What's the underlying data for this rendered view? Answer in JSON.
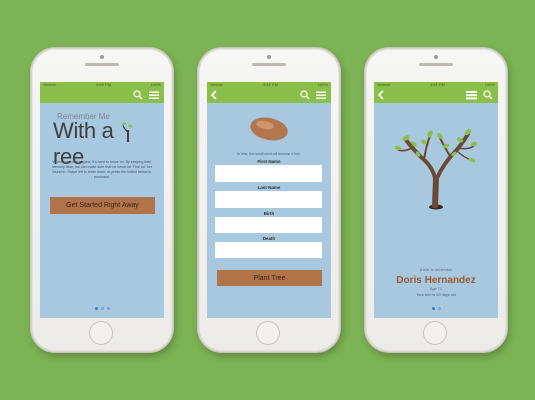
{
  "colors": {
    "background": "#7cb354",
    "header_green": "#8bbf4c",
    "screen_blue": "#a8c8e0",
    "button_brown": "#b1744a",
    "name_brown": "#9b5a33"
  },
  "status": {
    "carrier": "Verizon",
    "time_left": "9:59 PM",
    "time_mid": "3:41 PM",
    "time_right": "3:41 PM",
    "battery": "100%"
  },
  "icons": {
    "search": "search-icon",
    "menu": "menu-icon",
    "back": "chevron-left-icon",
    "list": "list-icon"
  },
  "screen1": {
    "remember_me": "Remember Me",
    "with_a": "With a",
    "tree": "ree",
    "paragraph": "When someone is gone, it's hard to move on. By keeping their memory alive, we can make sure that he never be 'Fine for' her found in. Swipe left to learn more, or press the button below to purchase.",
    "cta": "Get Started Right Away"
  },
  "screen2": {
    "seed_caption": "In time, this small seed will become a tree.",
    "first_name_label": "First Name",
    "last_name_label": "Last Name",
    "birth_label": "Birth",
    "death_label": "Death",
    "submit": "Plant Tree"
  },
  "screen3": {
    "in_memory": "A tree to remember",
    "name": "Doris Hernandez",
    "age": "Age 71",
    "tree_status": "Your tree is 60 days old"
  }
}
